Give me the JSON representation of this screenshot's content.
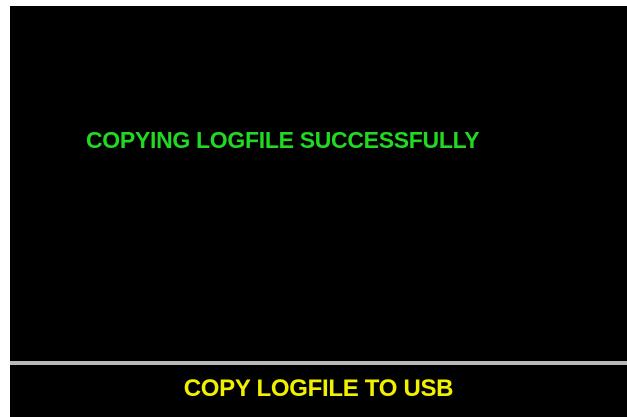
{
  "screen": {
    "message": "COPYING LOGFILE SUCCESSFULLY",
    "footer_title": "COPY LOGFILE TO USB"
  },
  "colors": {
    "background": "#000000",
    "message": "#22d822",
    "footer_title": "#f0f000",
    "divider": "#b8b8b8"
  }
}
